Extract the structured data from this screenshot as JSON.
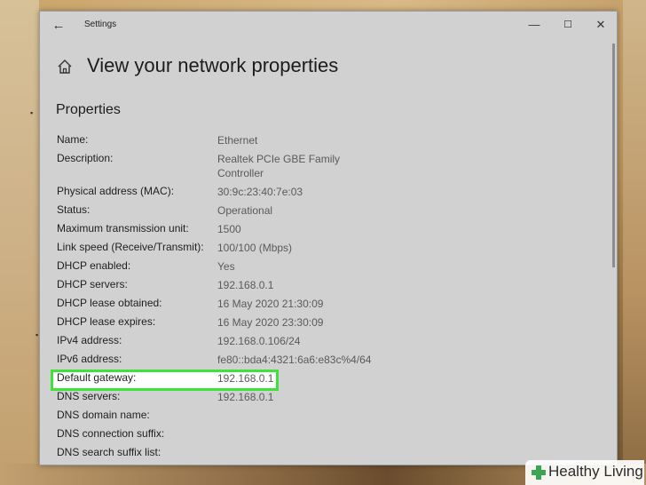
{
  "window": {
    "app_title": "Settings",
    "page_title": "View your network properties",
    "section_heading": "Properties"
  },
  "properties": [
    {
      "label": "Name:",
      "value": "Ethernet"
    },
    {
      "label": "Description:",
      "value": "Realtek PCIe GBE Family Controller"
    },
    {
      "label": "Physical address (MAC):",
      "value": "30:9c:23:40:7e:03"
    },
    {
      "label": "Status:",
      "value": "Operational"
    },
    {
      "label": "Maximum transmission unit:",
      "value": "1500"
    },
    {
      "label": "Link speed (Receive/Transmit):",
      "value": "100/100 (Mbps)"
    },
    {
      "label": "DHCP enabled:",
      "value": "Yes"
    },
    {
      "label": "DHCP servers:",
      "value": "192.168.0.1"
    },
    {
      "label": "DHCP lease obtained:",
      "value": "16 May 2020 21:30:09"
    },
    {
      "label": "DHCP lease expires:",
      "value": "16 May 2020 23:30:09"
    },
    {
      "label": "IPv4 address:",
      "value": "192.168.0.106/24"
    },
    {
      "label": "IPv6 address:",
      "value": "fe80::bda4:4321:6a6:e83c%4/64"
    },
    {
      "label": "Default gateway:",
      "value": "192.168.0.1"
    },
    {
      "label": "DNS servers:",
      "value": "192.168.0.1"
    },
    {
      "label": "DNS domain name:",
      "value": ""
    },
    {
      "label": "DNS connection suffix:",
      "value": ""
    },
    {
      "label": "DNS search suffix list:",
      "value": ""
    }
  ],
  "highlighted_property": "Default gateway:",
  "colors": {
    "highlight_border": "#3ee23b",
    "window_bg": "#d1d1d1"
  },
  "icons": {
    "back": "back-arrow-icon",
    "home": "home-icon",
    "minimize": "minimize-icon",
    "maximize": "maximize-icon",
    "close": "close-icon"
  },
  "watermark": {
    "text": "Healthy Living",
    "color": "#3aa655"
  }
}
